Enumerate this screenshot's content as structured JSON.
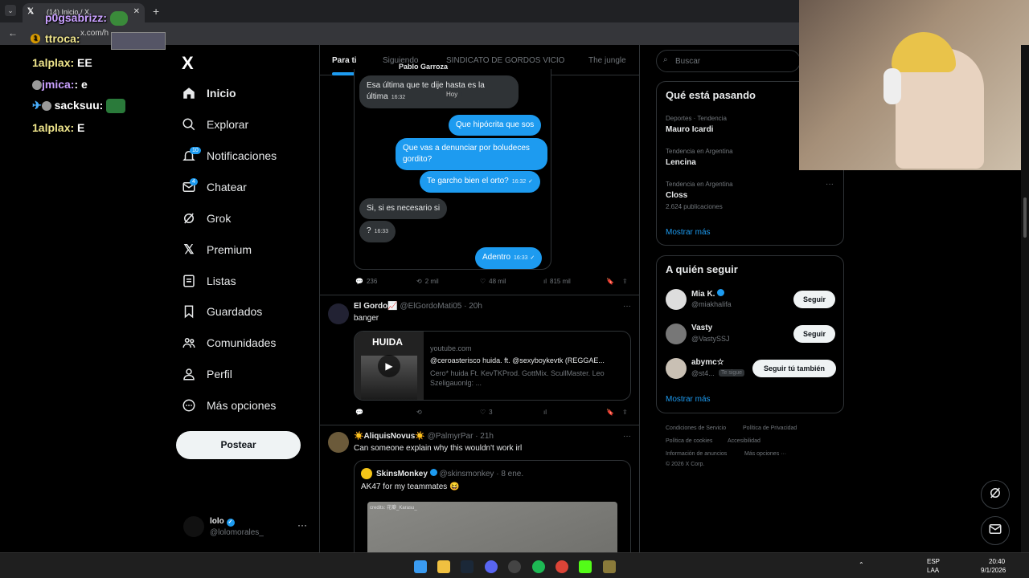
{
  "browser": {
    "tab_title": "(14) Inicio / X",
    "url": "x.com/h"
  },
  "overlay_chat": [
    {
      "user": "p0gsabrizz:",
      "msg": ""
    },
    {
      "user": "ttroca:",
      "msg": ""
    },
    {
      "user": "1alplax:",
      "msg": "EE"
    },
    {
      "user": "jmica:",
      "msg": "e"
    },
    {
      "user": "sacksuu:",
      "msg": ""
    },
    {
      "user": "1alplax:",
      "msg": "E"
    }
  ],
  "sidebar": {
    "logo": "X",
    "items": [
      {
        "label": "Inicio",
        "icon": "home-icon"
      },
      {
        "label": "Explorar",
        "icon": "search-icon"
      },
      {
        "label": "Notificaciones",
        "icon": "bell-icon",
        "badge": "10"
      },
      {
        "label": "Chatear",
        "icon": "mail-icon",
        "badge": "4"
      },
      {
        "label": "Grok",
        "icon": "grok-icon"
      },
      {
        "label": "Premium",
        "icon": "x-icon"
      },
      {
        "label": "Listas",
        "icon": "list-icon"
      },
      {
        "label": "Guardados",
        "icon": "bookmark-icon"
      },
      {
        "label": "Comunidades",
        "icon": "people-icon"
      },
      {
        "label": "Perfil",
        "icon": "person-icon"
      },
      {
        "label": "Más opciones",
        "icon": "more-icon"
      }
    ],
    "post_button": "Postear",
    "account": {
      "name": "lolo",
      "handle": "@lolomorales_"
    }
  },
  "feed": {
    "tabs": [
      "Para ti",
      "Siguiendo",
      "SINDICATO DE GORDOS VICIO",
      "The jungle"
    ],
    "dm": {
      "header": "Pablo Garroza",
      "date_pill": "Hoy",
      "messages": [
        {
          "dir": "in",
          "text": "Esa última que te dije hasta es la última",
          "time": "16:32"
        },
        {
          "dir": "out",
          "text": "Que hipócrita que sos",
          "time": ""
        },
        {
          "dir": "out",
          "text": "Que vas a denunciar por boludeces gordito?",
          "time": ""
        },
        {
          "dir": "out",
          "text": "Te garcho bien el orto?",
          "time": "16:32"
        },
        {
          "dir": "in",
          "text": "Si, si es necesario si",
          "time": ""
        },
        {
          "dir": "in",
          "text": "?",
          "time": "16:33"
        },
        {
          "dir": "out",
          "text": "Adentro",
          "time": "16:33"
        }
      ]
    },
    "post1_stats": {
      "replies": "236",
      "reposts": "2 mil",
      "likes": "48 mil",
      "views": "815 mil"
    },
    "post2": {
      "name": "El Gordo📈",
      "handle": "@ElGordoMati05 · 20h",
      "text": "banger",
      "card": {
        "domain": "youtube.com",
        "title": "@ceroasterisco huida. ft. @sexyboykevtk (REGGAE...",
        "desc": "Cero* huida Ft. KevTKProd. GottMix. ScullMaster. Leo Szeligauonlg: ..."
      },
      "thumb_title": "HUIDA",
      "likes": "3"
    },
    "post3": {
      "name": "☀️AliquisNovus☀️",
      "handle": "@PalmyrPar · 21h",
      "text": "Can someone explain why this wouldn't work irl",
      "quote": {
        "name": "SkinsMonkey",
        "handle": "@skinsmonkey · 8 ene.",
        "text": "AK47 for my teammates 😆",
        "media_credit": "credits: 花瓣_Karasu_"
      }
    }
  },
  "rightbar": {
    "search_placeholder": "Buscar",
    "trends_title": "Qué está pasando",
    "trends": [
      {
        "context": "Deportes · Tendencia",
        "name": "Mauro Icardi",
        "posts": ""
      },
      {
        "context": "Tendencia en Argentina",
        "name": "Lencina",
        "posts": ""
      },
      {
        "context": "Tendencia en Argentina",
        "name": "Closs",
        "posts": "2.624 publicaciones"
      }
    ],
    "show_more": "Mostrar más",
    "follow_title": "A quién seguir",
    "follows": [
      {
        "name": "Mia K.",
        "handle": "@miakhalifa",
        "button": "Seguir"
      },
      {
        "name": "Vasty",
        "handle": "@VastySSJ",
        "button": "Seguir"
      },
      {
        "name": "abymc☆",
        "handle": "@st4...",
        "tag": "Te sigue",
        "button": "Seguir tú también"
      }
    ],
    "footer": [
      "Condiciones de Servicio",
      "Política de Privacidad",
      "Política de cookies",
      "Accesibilidad",
      "Información de anuncios",
      "Más opciones ···",
      "© 2026 X Corp."
    ]
  },
  "taskbar": {
    "lang": "ESP",
    "lang2": "LAA",
    "time": "20:40",
    "date": "9/1/2026"
  },
  "colors": {
    "accent": "#1d9bf0",
    "bg": "#000000",
    "border": "#2f3336",
    "muted": "#71767b"
  }
}
